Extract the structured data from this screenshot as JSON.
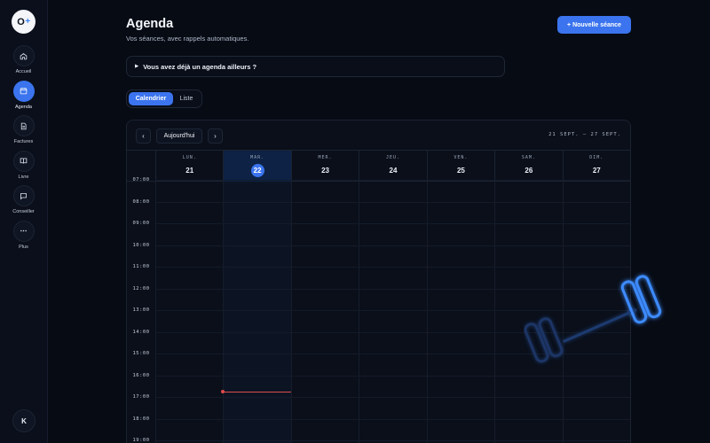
{
  "sidebar": {
    "logo_text": "O",
    "logo_plus": "+",
    "items": [
      {
        "label": "Accueil",
        "icon": "home-icon",
        "active": false
      },
      {
        "label": "Agenda",
        "icon": "calendar-icon",
        "active": true
      },
      {
        "label": "Factures",
        "icon": "invoice-icon",
        "active": false
      },
      {
        "label": "Livre",
        "icon": "book-icon",
        "active": false
      },
      {
        "label": "Conseiller",
        "icon": "chat-icon",
        "active": false
      },
      {
        "label": "Plus",
        "icon": "more-icon",
        "active": false
      }
    ],
    "avatar": "K"
  },
  "header": {
    "title": "Agenda",
    "subtitle": "Vos séances, avec rappels automatiques.",
    "new_button": "+ Nouvelle séance"
  },
  "details": {
    "summary": "Vous avez déjà un agenda ailleurs ?"
  },
  "view_toggle": {
    "calendar": "Calendrier",
    "list": "Liste",
    "selected": "Calendrier"
  },
  "calendar": {
    "prev": "‹",
    "next": "›",
    "today_button": "Aujourd'hui",
    "range": "21 SEPT. – 27 SEPT.",
    "days": [
      {
        "dow": "LUN.",
        "num": "21",
        "today": false
      },
      {
        "dow": "MAR.",
        "num": "22",
        "today": true
      },
      {
        "dow": "MER.",
        "num": "23",
        "today": false
      },
      {
        "dow": "JEU.",
        "num": "24",
        "today": false
      },
      {
        "dow": "VEN.",
        "num": "25",
        "today": false
      },
      {
        "dow": "SAM.",
        "num": "26",
        "today": false
      },
      {
        "dow": "DIM.",
        "num": "27",
        "today": false
      }
    ],
    "hours": [
      "07:00",
      "08:00",
      "09:00",
      "10:00",
      "11:00",
      "12:00",
      "13:00",
      "14:00",
      "15:00",
      "16:00",
      "17:00",
      "18:00",
      "19:00"
    ],
    "current_time": "16:45"
  },
  "colors": {
    "accent": "#3b74ee",
    "now_line": "#e04b4b",
    "background": "#070b14"
  }
}
